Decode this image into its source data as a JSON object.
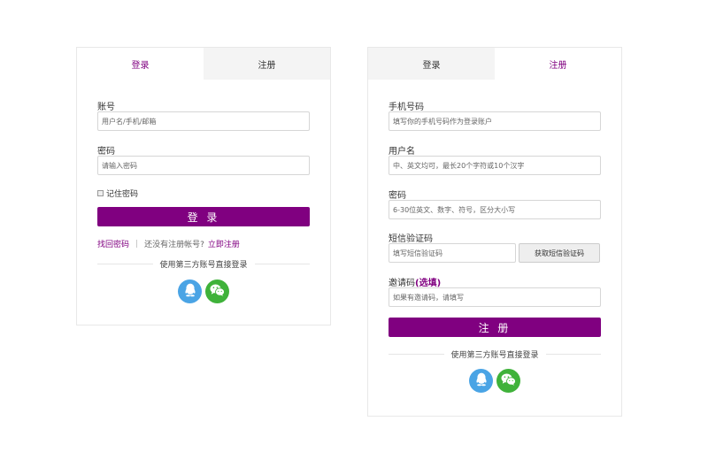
{
  "login": {
    "tabs": {
      "login": "登录",
      "register": "注册"
    },
    "account": {
      "label": "账号",
      "placeholder": "用户名/手机/邮箱"
    },
    "password": {
      "label": "密码",
      "placeholder": "请输入密码"
    },
    "remember": "记住密码",
    "submit": "登 录",
    "forgot": "找回密码",
    "no_account": "还没有注册帐号?",
    "register_now": "立即注册",
    "third_party": "使用第三方账号直接登录"
  },
  "register": {
    "tabs": {
      "login": "登录",
      "register": "注册"
    },
    "phone": {
      "label": "手机号码",
      "placeholder": "填写你的手机号码作为登录账户"
    },
    "username": {
      "label": "用户名",
      "placeholder": "中、英文均可，最长20个字符或10个汉字"
    },
    "password": {
      "label": "密码",
      "placeholder": "6-30位英文、数字、符号，区分大小写"
    },
    "sms": {
      "label": "短信验证码",
      "placeholder": "填写短信验证码",
      "button": "获取短信验证码"
    },
    "invite": {
      "label": "邀请码",
      "optional": "(选填)",
      "placeholder": "如果有邀请码，请填写"
    },
    "submit": "注 册",
    "third_party": "使用第三方账号直接登录"
  },
  "colors": {
    "accent": "#800080",
    "qq": "#4aa4e5",
    "wechat": "#3fb23a"
  },
  "icons": [
    "qq-icon",
    "wechat-icon"
  ]
}
